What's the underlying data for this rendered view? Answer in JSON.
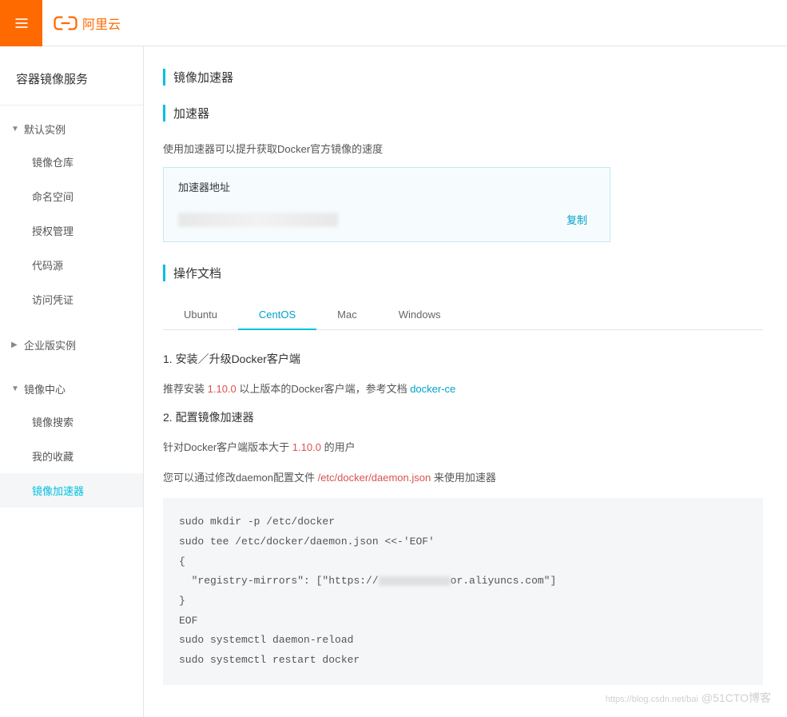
{
  "header": {
    "logo_text": "阿里云"
  },
  "sidebar": {
    "service_title": "容器镜像服务",
    "groups": [
      {
        "label": "默认实例",
        "expanded": true,
        "items": [
          {
            "label": "镜像仓库",
            "active": false
          },
          {
            "label": "命名空间",
            "active": false
          },
          {
            "label": "授权管理",
            "active": false
          },
          {
            "label": "代码源",
            "active": false
          },
          {
            "label": "访问凭证",
            "active": false
          }
        ]
      },
      {
        "label": "企业版实例",
        "expanded": false,
        "items": []
      },
      {
        "label": "镜像中心",
        "expanded": true,
        "items": [
          {
            "label": "镜像搜索",
            "active": false
          },
          {
            "label": "我的收藏",
            "active": false
          },
          {
            "label": "镜像加速器",
            "active": true
          }
        ]
      }
    ]
  },
  "page": {
    "title": "镜像加速器",
    "accelerator": {
      "heading": "加速器",
      "desc": "使用加速器可以提升获取Docker官方镜像的速度",
      "addr_label": "加速器地址",
      "copy_label": "复制"
    },
    "docs": {
      "heading": "操作文档",
      "tabs": [
        "Ubuntu",
        "CentOS",
        "Mac",
        "Windows"
      ],
      "active_tab": "CentOS",
      "step1_title": "1. 安装／升级Docker客户端",
      "step1_prefix": "推荐安装 ",
      "step1_version": "1.10.0",
      "step1_mid": " 以上版本的Docker客户端，参考文档 ",
      "step1_link": "docker-ce",
      "step2_title": "2. 配置镜像加速器",
      "step2_p1_prefix": "针对Docker客户端版本大于 ",
      "step2_p1_ver": "1.10.0",
      "step2_p1_suffix": " 的用户",
      "step2_p2_prefix": "您可以通过修改daemon配置文件 ",
      "step2_p2_path": "/etc/docker/daemon.json",
      "step2_p2_suffix": " 来使用加速器",
      "code_l1": "sudo mkdir -p /etc/docker",
      "code_l2": "sudo tee /etc/docker/daemon.json <<-'EOF'",
      "code_l3": "{",
      "code_l4a": "  \"registry-mirrors\": [\"https://",
      "code_l4b": "or.aliyuncs.com\"]",
      "code_l5": "}",
      "code_l6": "EOF",
      "code_l7": "sudo systemctl daemon-reload",
      "code_l8": "sudo systemctl restart docker"
    }
  },
  "watermark": {
    "blog": "https://blog.csdn.net/bai",
    "brand": "@51CTO博客"
  }
}
